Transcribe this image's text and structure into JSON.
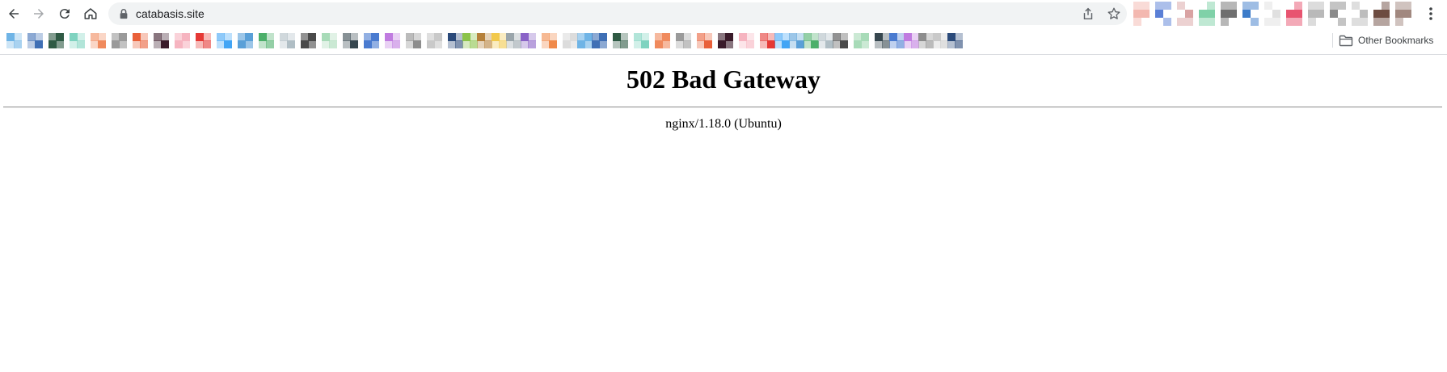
{
  "browser": {
    "url": "catabasis.site",
    "other_bookmarks_label": "Other Bookmarks",
    "icons": {
      "back": "back-arrow-icon",
      "forward": "forward-arrow-icon",
      "reload": "reload-icon",
      "home": "home-icon",
      "lock": "lock-icon",
      "share": "share-icon",
      "star": "bookmark-star-icon",
      "menu": "kebab-menu-icon",
      "folder": "folder-icon"
    }
  },
  "page": {
    "heading": "502 Bad Gateway",
    "server_line": "nginx/1.18.0 (Ubuntu)"
  },
  "colors": {
    "omnibox_bg": "#f1f3f4",
    "toolbar_icon": "#5f6368",
    "forward_disabled": "#a5a8ab"
  }
}
